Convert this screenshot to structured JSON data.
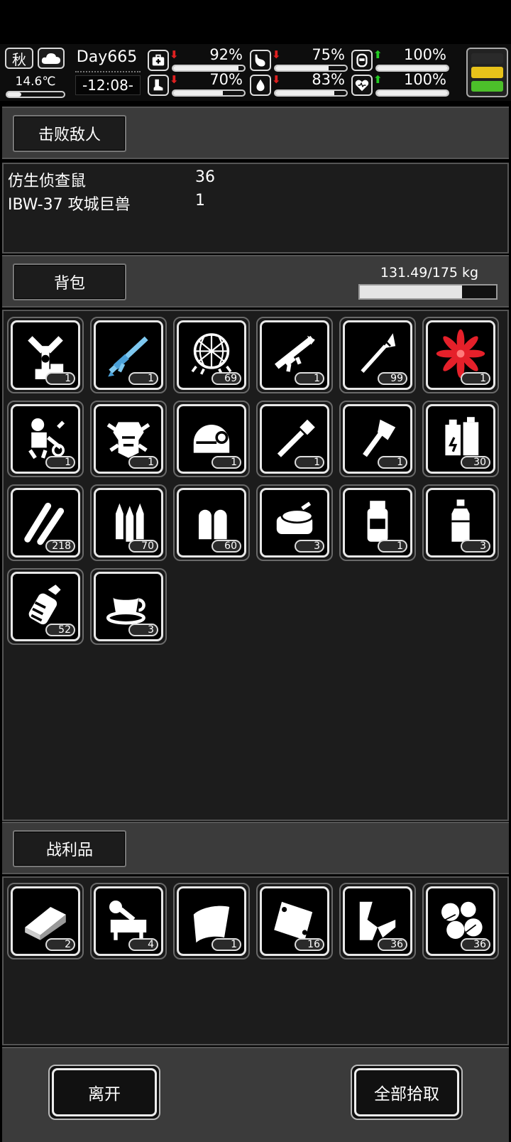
{
  "status": {
    "season": "秋",
    "temperature": "14.6℃",
    "temperature_level": 0.25,
    "day": "Day665",
    "clock": "-12:08-",
    "stats": [
      {
        "key": "health",
        "icon": "medkit-icon",
        "trend": "down",
        "arrow": "⬇",
        "percent_text": "92%",
        "value": 92
      },
      {
        "key": "hunger",
        "icon": "stomach-icon",
        "trend": "down",
        "arrow": "⬇",
        "percent_text": "75%",
        "value": 75
      },
      {
        "key": "mood",
        "icon": "face-icon",
        "trend": "up",
        "arrow": "⬆",
        "percent_text": "100%",
        "value": 100
      },
      {
        "key": "stamina",
        "icon": "boot-icon",
        "trend": "down",
        "arrow": "⬇",
        "percent_text": "70%",
        "value": 70
      },
      {
        "key": "thirst",
        "icon": "water-drop-icon",
        "trend": "down",
        "arrow": "⬇",
        "percent_text": "83%",
        "value": 83
      },
      {
        "key": "heart",
        "icon": "heart-icon",
        "trend": "up",
        "arrow": "⬆",
        "percent_text": "100%",
        "value": 100
      }
    ],
    "battery": {
      "colors": [
        "#2a2a2a",
        "#e8c21a",
        "#4cbf2a"
      ]
    }
  },
  "defeated": {
    "title": "击败敌人",
    "enemies": [
      {
        "name": "仿生侦查鼠",
        "count": "36"
      },
      {
        "name": "IBW-37 攻城巨兽",
        "count": "1"
      }
    ]
  },
  "backpack": {
    "title": "背包",
    "weight_text": "131.49/175 kg",
    "weight_ratio": 0.7514,
    "items": [
      {
        "icon": "pipe-machine-icon",
        "qty": "1"
      },
      {
        "icon": "sniper-rifle-icon",
        "qty": "1"
      },
      {
        "icon": "net-icon",
        "qty": "69"
      },
      {
        "icon": "rocket-launcher-icon",
        "qty": "1"
      },
      {
        "icon": "rocket-ammo-icon",
        "qty": "99"
      },
      {
        "icon": "red-flower-icon",
        "qty": "1"
      },
      {
        "icon": "robot-parts-icon",
        "qty": "1"
      },
      {
        "icon": "mech-armor-icon",
        "qty": "1"
      },
      {
        "icon": "helmet-icon",
        "qty": "1"
      },
      {
        "icon": "shovel-icon",
        "qty": "1"
      },
      {
        "icon": "axe-icon",
        "qty": "1"
      },
      {
        "icon": "battery-pack-icon",
        "qty": "30"
      },
      {
        "icon": "rifle-bullets-icon",
        "qty": "218"
      },
      {
        "icon": "bullets-icon",
        "qty": "70"
      },
      {
        "icon": "pistol-bullets-icon",
        "qty": "60"
      },
      {
        "icon": "canned-food-icon",
        "qty": "3"
      },
      {
        "icon": "drink-bottle-icon",
        "qty": "1"
      },
      {
        "icon": "water-bottle-icon",
        "qty": "3"
      },
      {
        "icon": "grenade-icon",
        "qty": "52"
      },
      {
        "icon": "coffee-cup-icon",
        "qty": "3"
      }
    ]
  },
  "loot": {
    "title": "战利品",
    "items": [
      {
        "icon": "metal-plate-icon",
        "qty": "2"
      },
      {
        "icon": "mech-component-icon",
        "qty": "4"
      },
      {
        "icon": "cloth-icon",
        "qty": "1"
      },
      {
        "icon": "metal-sheet-icon",
        "qty": "16"
      },
      {
        "icon": "scrap-metal-icon",
        "qty": "36"
      },
      {
        "icon": "stones-icon",
        "qty": "36"
      }
    ]
  },
  "actions": {
    "leave": "离开",
    "take_all": "全部拾取"
  }
}
